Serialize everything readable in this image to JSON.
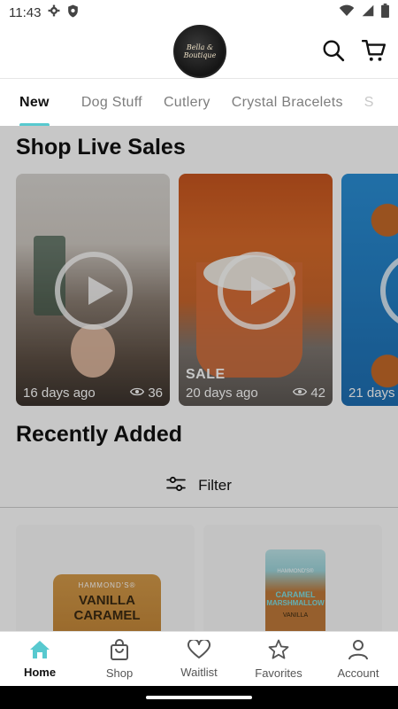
{
  "status_bar": {
    "time": "11:43"
  },
  "header": {
    "logo_text": "Bella & Boutique"
  },
  "tabs": [
    {
      "label": "New",
      "active": true
    },
    {
      "label": "Dog Stuff"
    },
    {
      "label": "Cutlery"
    },
    {
      "label": "Crystal Bracelets"
    },
    {
      "label": "S"
    }
  ],
  "live_sales": {
    "title": "Shop Live Sales",
    "cards": [
      {
        "age": "16 days ago",
        "views": "36"
      },
      {
        "badge": "SALE",
        "age": "20 days ago",
        "views": "42"
      },
      {
        "age": "21 days"
      }
    ]
  },
  "recently_added": {
    "title": "Recently Added",
    "filter_label": "Filter"
  },
  "products": [
    {
      "brand": "HAMMOND'S®",
      "name_line1": "VANILLA",
      "name_line2": "CARAMEL"
    },
    {
      "brand": "HAMMOND'S®",
      "name_line1": "CARAMEL",
      "name_line2": "MARSHMALLOW",
      "flavor": "VANILLA"
    }
  ],
  "bottom_nav": [
    {
      "label": "Home",
      "icon": "home-icon",
      "active": true
    },
    {
      "label": "Shop",
      "icon": "shopping-bag-icon"
    },
    {
      "label": "Waitlist",
      "icon": "heart-icon"
    },
    {
      "label": "Favorites",
      "icon": "star-icon"
    },
    {
      "label": "Account",
      "icon": "account-icon"
    }
  ],
  "colors": {
    "accent": "#58c9cf",
    "home_icon": "#58c9cf"
  }
}
